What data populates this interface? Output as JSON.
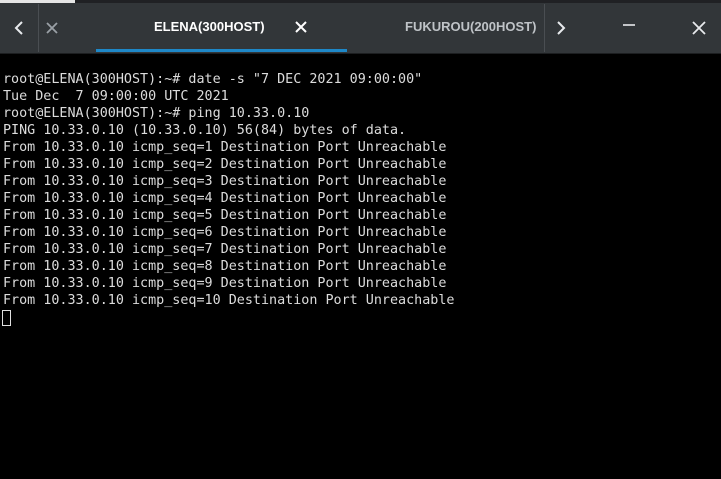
{
  "tabbar": {
    "tabs": [
      {
        "label": "ELENA(300HOST)",
        "active": true
      },
      {
        "label": "FUKUROU(200HOST)",
        "active": false
      }
    ],
    "accent_color": "#1e88c8",
    "icons": {
      "left": "chevron-left-icon",
      "right": "chevron-right-icon",
      "close": "close-icon",
      "minimize": "minimize-icon"
    }
  },
  "terminal": {
    "lines": [
      "root@ELENA(300HOST):~# date -s \"7 DEC 2021 09:00:00\"",
      "Tue Dec  7 09:00:00 UTC 2021",
      "root@ELENA(300HOST):~# ping 10.33.0.10",
      "PING 10.33.0.10 (10.33.0.10) 56(84) bytes of data.",
      "From 10.33.0.10 icmp_seq=1 Destination Port Unreachable",
      "From 10.33.0.10 icmp_seq=2 Destination Port Unreachable",
      "From 10.33.0.10 icmp_seq=3 Destination Port Unreachable",
      "From 10.33.0.10 icmp_seq=4 Destination Port Unreachable",
      "From 10.33.0.10 icmp_seq=5 Destination Port Unreachable",
      "From 10.33.0.10 icmp_seq=6 Destination Port Unreachable",
      "From 10.33.0.10 icmp_seq=7 Destination Port Unreachable",
      "From 10.33.0.10 icmp_seq=8 Destination Port Unreachable",
      "From 10.33.0.10 icmp_seq=9 Destination Port Unreachable",
      "From 10.33.0.10 icmp_seq=10 Destination Port Unreachable"
    ],
    "background": "#000000",
    "foreground": "#dcdcdc"
  }
}
